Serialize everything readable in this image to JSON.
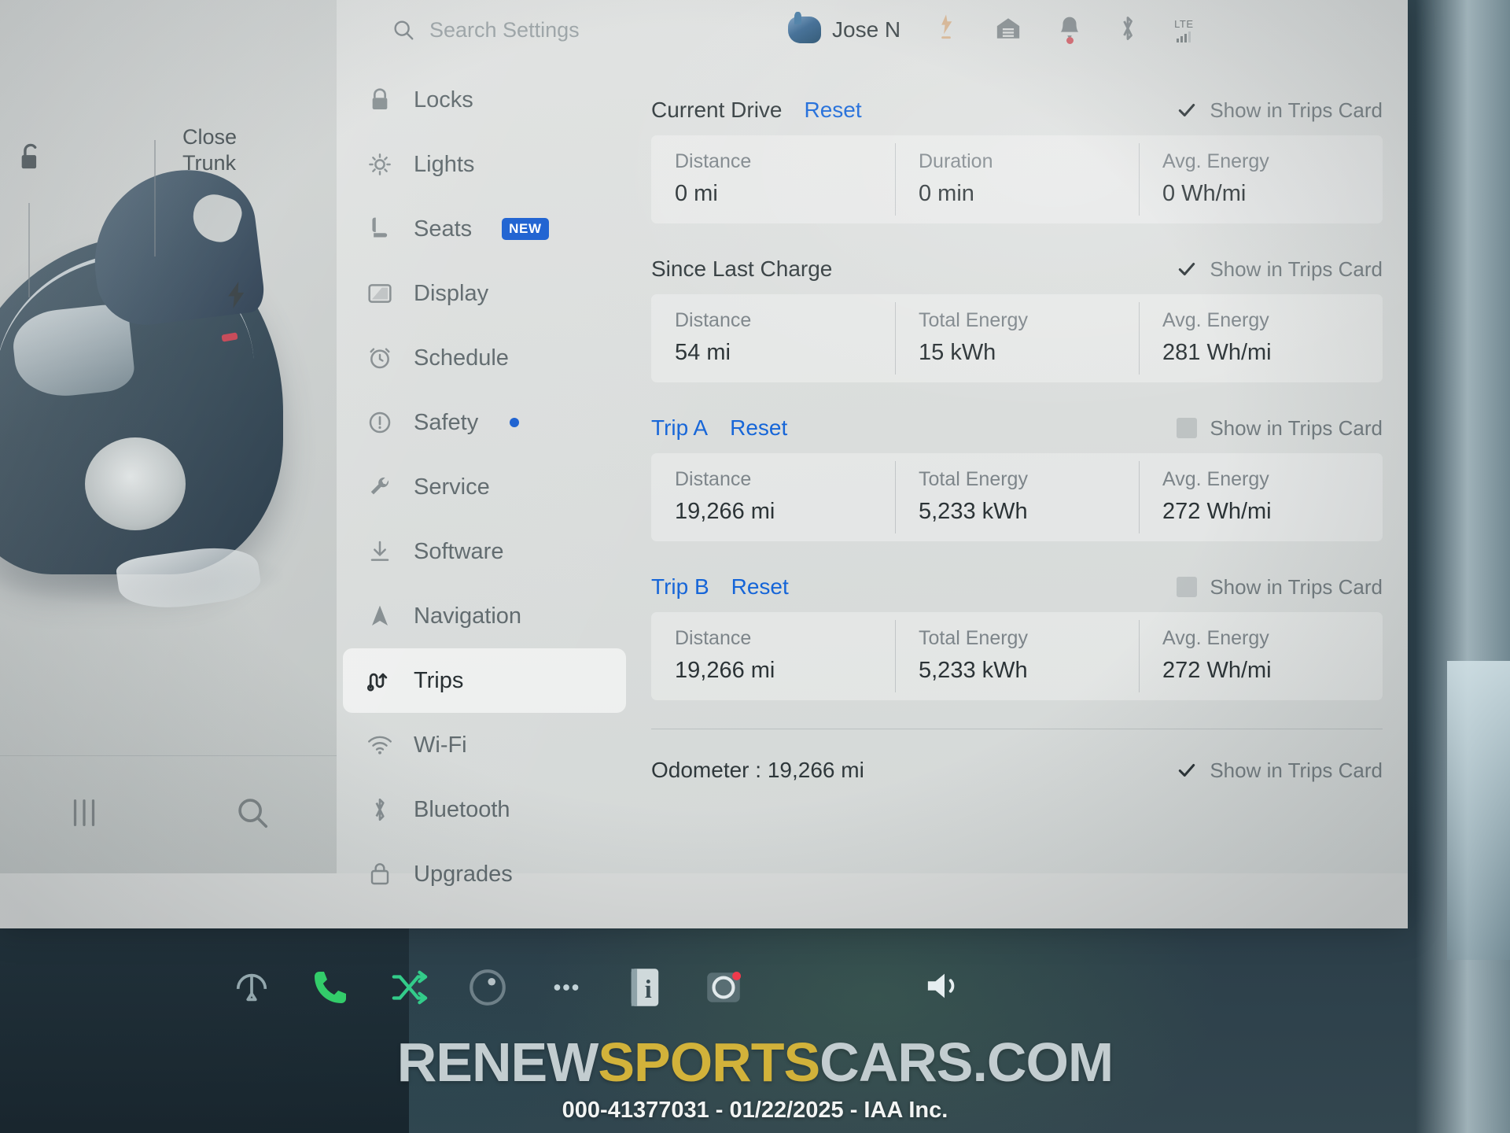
{
  "search": {
    "placeholder": "Search Settings",
    "icon": "search-icon"
  },
  "user": {
    "name": "Jose N"
  },
  "status_bar": {
    "icons": [
      {
        "name": "charging-icon",
        "label": "Charging"
      },
      {
        "name": "garage-icon",
        "label": "Garage"
      },
      {
        "name": "bell-icon",
        "label": "Notifications"
      },
      {
        "name": "bluetooth-icon",
        "label": "Bluetooth"
      }
    ],
    "network": {
      "type": "LTE",
      "bars": 3
    }
  },
  "car_panel": {
    "close_trunk_line1": "Close",
    "close_trunk_line2": "Trunk",
    "unlock_icon": "unlock-icon",
    "charge_port_icon": "lightning-bolt-icon",
    "bottom_buttons": [
      {
        "name": "sliders-icon",
        "label": "Controls"
      },
      {
        "name": "search-icon",
        "label": "Search"
      }
    ]
  },
  "sidebar": {
    "items": [
      {
        "label": "Locks",
        "icon": "lock-icon",
        "active": false
      },
      {
        "label": "Lights",
        "icon": "lights-icon",
        "active": false
      },
      {
        "label": "Seats",
        "icon": "seat-icon",
        "active": false,
        "badge": "NEW"
      },
      {
        "label": "Display",
        "icon": "display-icon",
        "active": false
      },
      {
        "label": "Schedule",
        "icon": "clock-icon",
        "active": false
      },
      {
        "label": "Safety",
        "icon": "alert-icon",
        "active": false,
        "dot": true
      },
      {
        "label": "Service",
        "icon": "wrench-icon",
        "active": false
      },
      {
        "label": "Software",
        "icon": "download-icon",
        "active": false
      },
      {
        "label": "Navigation",
        "icon": "navigation-icon",
        "active": false
      },
      {
        "label": "Trips",
        "icon": "trips-icon",
        "active": true
      },
      {
        "label": "Wi-Fi",
        "icon": "wifi-icon",
        "active": false
      },
      {
        "label": "Bluetooth",
        "icon": "bluetooth-icon",
        "active": false
      },
      {
        "label": "Upgrades",
        "icon": "bag-icon",
        "active": false
      }
    ]
  },
  "trips": {
    "show_in_trips_card_label": "Show in Trips Card",
    "reset_label": "Reset",
    "sections": [
      {
        "title": "Current Drive",
        "has_reset": true,
        "checked": true,
        "stats": [
          {
            "label": "Distance",
            "value": "0 mi"
          },
          {
            "label": "Duration",
            "value": "0 min"
          },
          {
            "label": "Avg. Energy",
            "value": "0 Wh/mi"
          }
        ]
      },
      {
        "title": "Since Last Charge",
        "has_reset": false,
        "checked": true,
        "stats": [
          {
            "label": "Distance",
            "value": "54 mi"
          },
          {
            "label": "Total Energy",
            "value": "15 kWh"
          },
          {
            "label": "Avg. Energy",
            "value": "281 Wh/mi"
          }
        ]
      },
      {
        "title": "Trip A",
        "has_reset": true,
        "checked": false,
        "stats": [
          {
            "label": "Distance",
            "value": "19,266 mi"
          },
          {
            "label": "Total Energy",
            "value": "5,233 kWh"
          },
          {
            "label": "Avg. Energy",
            "value": "272 Wh/mi"
          }
        ]
      },
      {
        "title": "Trip B",
        "has_reset": true,
        "checked": false,
        "stats": [
          {
            "label": "Distance",
            "value": "19,266 mi"
          },
          {
            "label": "Total Energy",
            "value": "5,233 kWh"
          },
          {
            "label": "Avg. Energy",
            "value": "272 Wh/mi"
          }
        ]
      }
    ],
    "odometer": {
      "text": "Odometer : 19,266 mi",
      "checked": true
    }
  },
  "dock": {
    "items": [
      {
        "name": "wiper-icon",
        "label": "Wipers"
      },
      {
        "name": "phone-icon",
        "label": "Phone"
      },
      {
        "name": "shuffle-icon",
        "label": "Shuffle"
      },
      {
        "name": "media-icon",
        "label": "Media"
      },
      {
        "name": "more-icon",
        "label": "More"
      },
      {
        "name": "info-icon",
        "label": "Info"
      },
      {
        "name": "dashcam-icon",
        "label": "Dashcam"
      }
    ],
    "volume": {
      "name": "volume-icon",
      "label": "Volume"
    }
  },
  "watermark": {
    "part1": "RENEW",
    "part2": "SPORTS",
    "part3": "CARS.COM",
    "subtitle": "000-41377031 - 01/22/2025 - IAA Inc."
  },
  "colors": {
    "accent_blue": "#1565d8",
    "badge_blue": "#1a5fd0",
    "screen_bg": "#dcdedd",
    "watermark_gold": "#d2b23a"
  }
}
